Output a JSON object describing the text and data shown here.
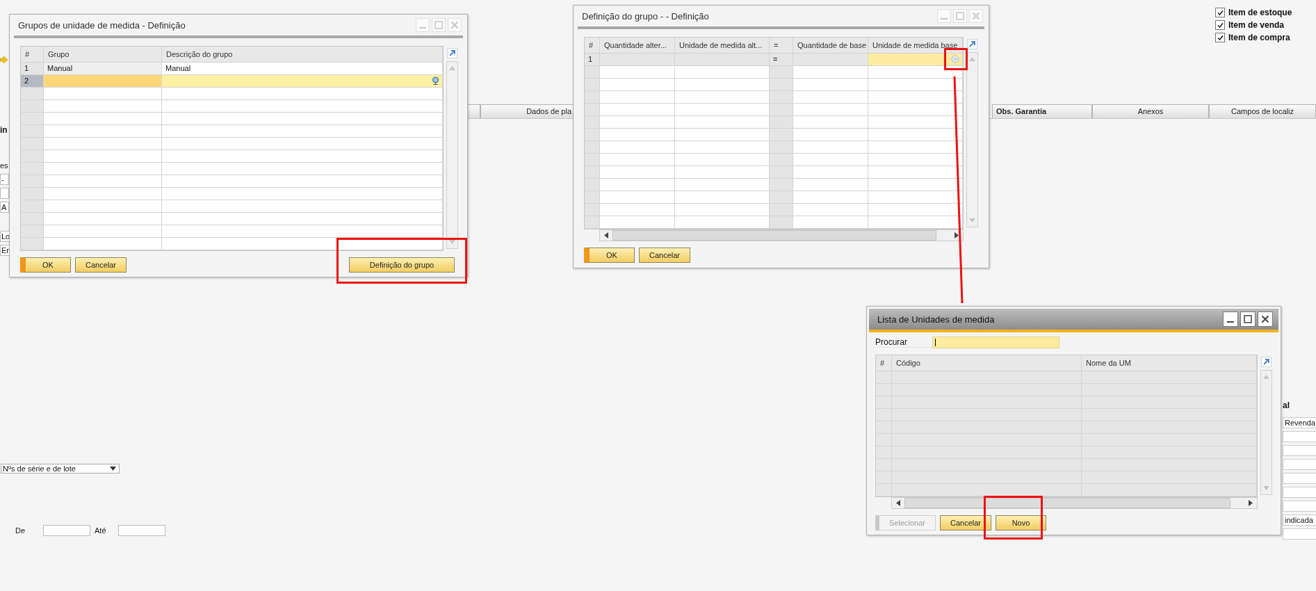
{
  "background": {
    "checkboxes": [
      {
        "label": "Item de estoque",
        "checked": true
      },
      {
        "label": "Item de venda",
        "checked": true
      },
      {
        "label": "Item de compra",
        "checked": true
      }
    ],
    "tabs": [
      {
        "label": "Dados de pla",
        "selected": false
      },
      {
        "label": "Obs. Garantia",
        "selected": true
      },
      {
        "label": "Anexos",
        "selected": false
      },
      {
        "label": "Campos de localiz",
        "selected": false
      }
    ],
    "left_fragments": [
      {
        "kind": "label",
        "text": "in"
      },
      {
        "kind": "text",
        "text": "es"
      },
      {
        "kind": "field",
        "text": "-"
      },
      {
        "kind": "blank"
      },
      {
        "kind": "field",
        "text": "A"
      },
      {
        "kind": "field",
        "text": "Lo"
      },
      {
        "kind": "field",
        "text": "En"
      }
    ],
    "right_fragments": [
      {
        "kind": "label",
        "text": "al"
      },
      {
        "kind": "field",
        "text": "Revenda"
      },
      {
        "kind": "blank"
      },
      {
        "kind": "blank"
      },
      {
        "kind": "blank"
      },
      {
        "kind": "blank"
      },
      {
        "kind": "blank"
      },
      {
        "kind": "blank"
      },
      {
        "kind": "field",
        "text": "indicada"
      },
      {
        "kind": "blank"
      }
    ],
    "series_dropdown": {
      "value": "Nºs de série e de lote"
    },
    "range": {
      "from_label": "De",
      "to_label": "Até"
    }
  },
  "windows": [
    {
      "title": "Grupos de unidade de medida - Definição",
      "active": false,
      "columns": [
        "#",
        "Grupo",
        "Descrição do grupo"
      ],
      "rows": [
        {
          "number": "1",
          "group": "Manual",
          "description": "Manual",
          "selected": false
        },
        {
          "number": "2",
          "selected": true
        }
      ],
      "buttons": [
        {
          "label": "OK",
          "default": true,
          "disabled": false
        },
        {
          "label": "Cancelar",
          "default": false,
          "disabled": false
        },
        {
          "label": "Definição do grupo",
          "default": false,
          "disabled": false
        }
      ]
    },
    {
      "title": "Definição do grupo -  - Definição",
      "active": false,
      "columns": [
        "#",
        "Quantidade alter...",
        "Unidade de medida alt...",
        "=",
        "Quantidade de base",
        "Unidade de medida base"
      ],
      "rows": [
        {
          "number": "1",
          "equals": "=",
          "selected": true
        }
      ],
      "buttons": [
        {
          "label": "OK",
          "default": true,
          "disabled": false
        },
        {
          "label": "Cancelar",
          "default": false,
          "disabled": false
        }
      ]
    },
    {
      "title": "Lista de Unidades de medida",
      "active": true,
      "search": {
        "label": "Procurar"
      },
      "columns": [
        "#",
        "Código",
        "Nome da UM"
      ],
      "buttons": [
        {
          "label": "Selecionar",
          "default": false,
          "disabled": true
        },
        {
          "label": "Cancelar",
          "default": false,
          "disabled": false
        },
        {
          "label": "Novo",
          "default": false,
          "disabled": false
        }
      ]
    }
  ]
}
